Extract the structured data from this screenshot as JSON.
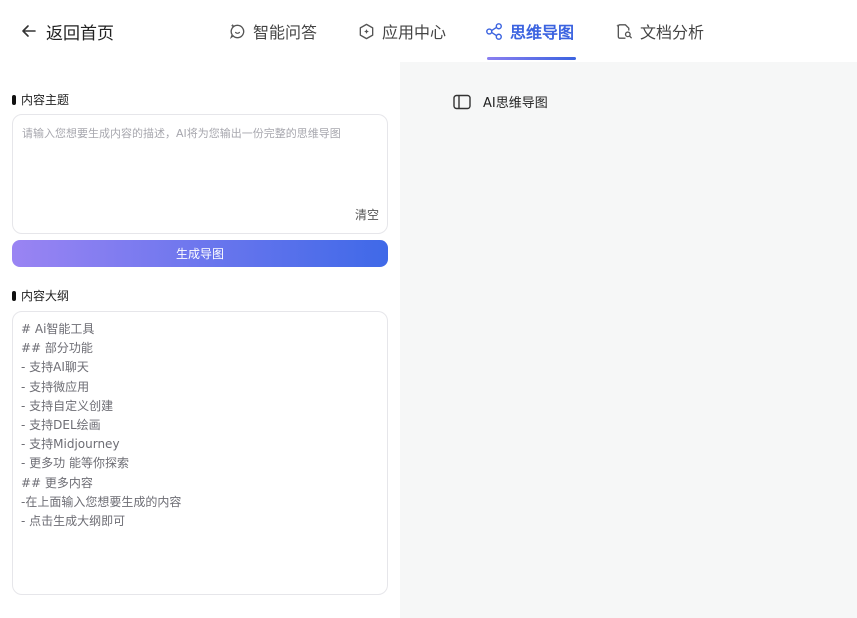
{
  "header": {
    "back_label": "返回首页",
    "tabs": [
      {
        "label": "智能问答",
        "icon": "sparkle-chat-icon"
      },
      {
        "label": "应用中心",
        "icon": "cube-icon"
      },
      {
        "label": "思维导图",
        "icon": "mindmap-icon",
        "active": true
      },
      {
        "label": "文档分析",
        "icon": "document-search-icon"
      }
    ],
    "active_color": "#3b63e0"
  },
  "left": {
    "topic_title": "内容主题",
    "topic_placeholder": "请输入您想要生成内容的描述，AI将为您输出一份完整的思维导图",
    "clear_label": "清空",
    "generate_label": "生成导图",
    "outline_title": "内容大纲",
    "outline_lines": [
      "# Ai智能工具",
      "## 部分功能",
      "- 支持AI聊天",
      "- 支持微应用",
      "- 支持自定义创建",
      "- 支持DEL绘画",
      "- 支持Midjourney",
      "- 更多功 能等你探索",
      "## 更多内容",
      "-在上面输入您想要生成的内容",
      "- 点击生成大纲即可"
    ]
  },
  "right": {
    "title": "AI思维导图",
    "icon": "sidebar-panel-icon"
  }
}
